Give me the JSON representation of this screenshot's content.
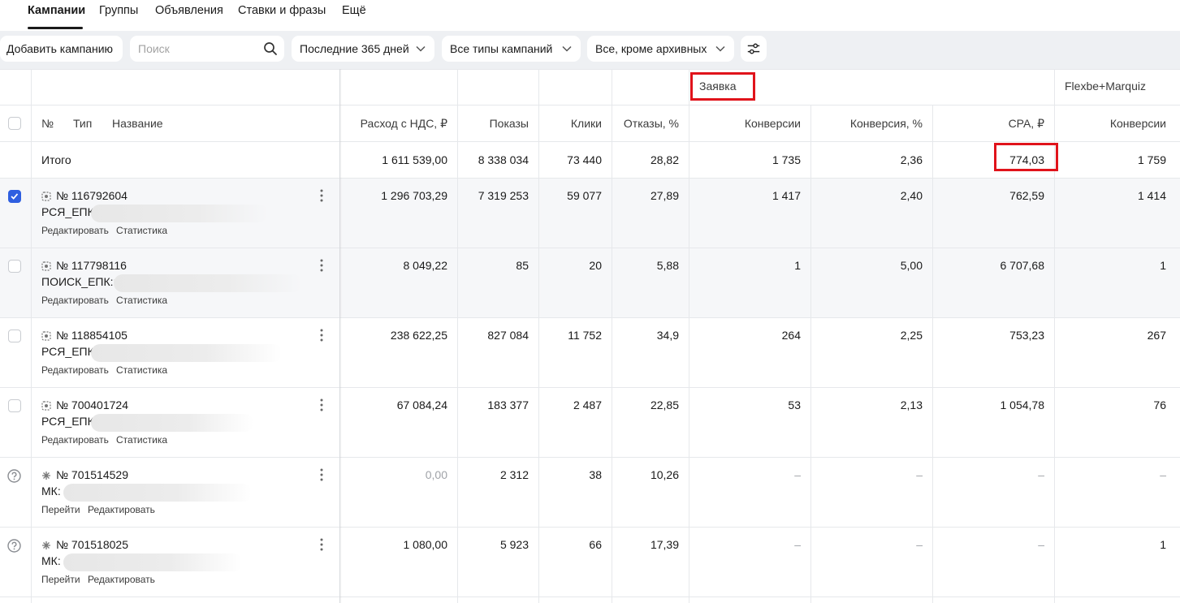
{
  "tabs": [
    "Кампании",
    "Группы",
    "Объявления",
    "Ставки и фразы",
    "Ещё"
  ],
  "toolbar": {
    "add_campaign": "Добавить кампанию",
    "search_placeholder": "Поиск",
    "period": "Последние 365 дней",
    "campaign_types": "Все типы кампаний",
    "status_filter": "Все, кроме архивных"
  },
  "table": {
    "group_headers": {
      "goal1": "Заявка",
      "goal2": "Flexbe+Marquiz"
    },
    "headers": {
      "num": "№",
      "type": "Тип",
      "name": "Название",
      "cost": "Расход с НДС, ₽",
      "impressions": "Показы",
      "clicks": "Клики",
      "bounce": "Отказы, %",
      "conversions": "Конверсии",
      "conv_rate": "Конверсия, %",
      "cpa": "CPA, ₽",
      "conversions2": "Конверсии"
    },
    "total": {
      "label": "Итого",
      "cost": "1 611 539,00",
      "impressions": "8 338 034",
      "clicks": "73 440",
      "bounce": "28,82",
      "conversions": "1 735",
      "conv_rate": "2,36",
      "cpa": "774,03",
      "conversions2": "1 759"
    },
    "rows": [
      {
        "id": "№ 116792604",
        "name": "РСЯ_ЕПК",
        "link1": "Редактировать",
        "link2": "Статистика",
        "cost": "1 296 703,29",
        "impressions": "7 319 253",
        "clicks": "59 077",
        "bounce": "27,89",
        "conversions": "1 417",
        "conv_rate": "2,40",
        "cpa": "762,59",
        "conversions2": "1 414"
      },
      {
        "id": "№ 117798116",
        "name": "ПОИСК_ЕПК::",
        "link1": "Редактировать",
        "link2": "Статистика",
        "cost": "8 049,22",
        "impressions": "85",
        "clicks": "20",
        "bounce": "5,88",
        "conversions": "1",
        "conv_rate": "5,00",
        "cpa": "6 707,68",
        "conversions2": "1"
      },
      {
        "id": "№ 118854105",
        "name": "РСЯ_ЕПК",
        "link1": "Редактировать",
        "link2": "Статистика",
        "cost": "238 622,25",
        "impressions": "827 084",
        "clicks": "11 752",
        "bounce": "34,9",
        "conversions": "264",
        "conv_rate": "2,25",
        "cpa": "753,23",
        "conversions2": "267"
      },
      {
        "id": "№ 700401724",
        "name": "РСЯ_ЕПК",
        "link1": "Редактировать",
        "link2": "Статистика",
        "cost": "67 084,24",
        "impressions": "183 377",
        "clicks": "2 487",
        "bounce": "22,85",
        "conversions": "53",
        "conv_rate": "2,13",
        "cpa": "1 054,78",
        "conversions2": "76"
      },
      {
        "id": "№ 701514529",
        "name": "МК:",
        "link1": "Перейти",
        "link2": "Редактировать",
        "cost": "0,00",
        "impressions": "2 312",
        "clicks": "38",
        "bounce": "10,26",
        "conversions": "–",
        "conv_rate": "–",
        "cpa": "–",
        "conversions2": "–"
      },
      {
        "id": "№ 701518025",
        "name": "МК:",
        "link1": "Перейти",
        "link2": "Редактировать",
        "cost": "1 080,00",
        "impressions": "5 923",
        "clicks": "66",
        "bounce": "17,39",
        "conversions": "–",
        "conv_rate": "–",
        "cpa": "–",
        "conversions2": "1"
      }
    ]
  },
  "colors": {
    "accent": "#2f5fe0",
    "highlight": "#e0131b",
    "toolbar_bg": "#eef0f3",
    "selected_row": "#f6f7f9"
  }
}
